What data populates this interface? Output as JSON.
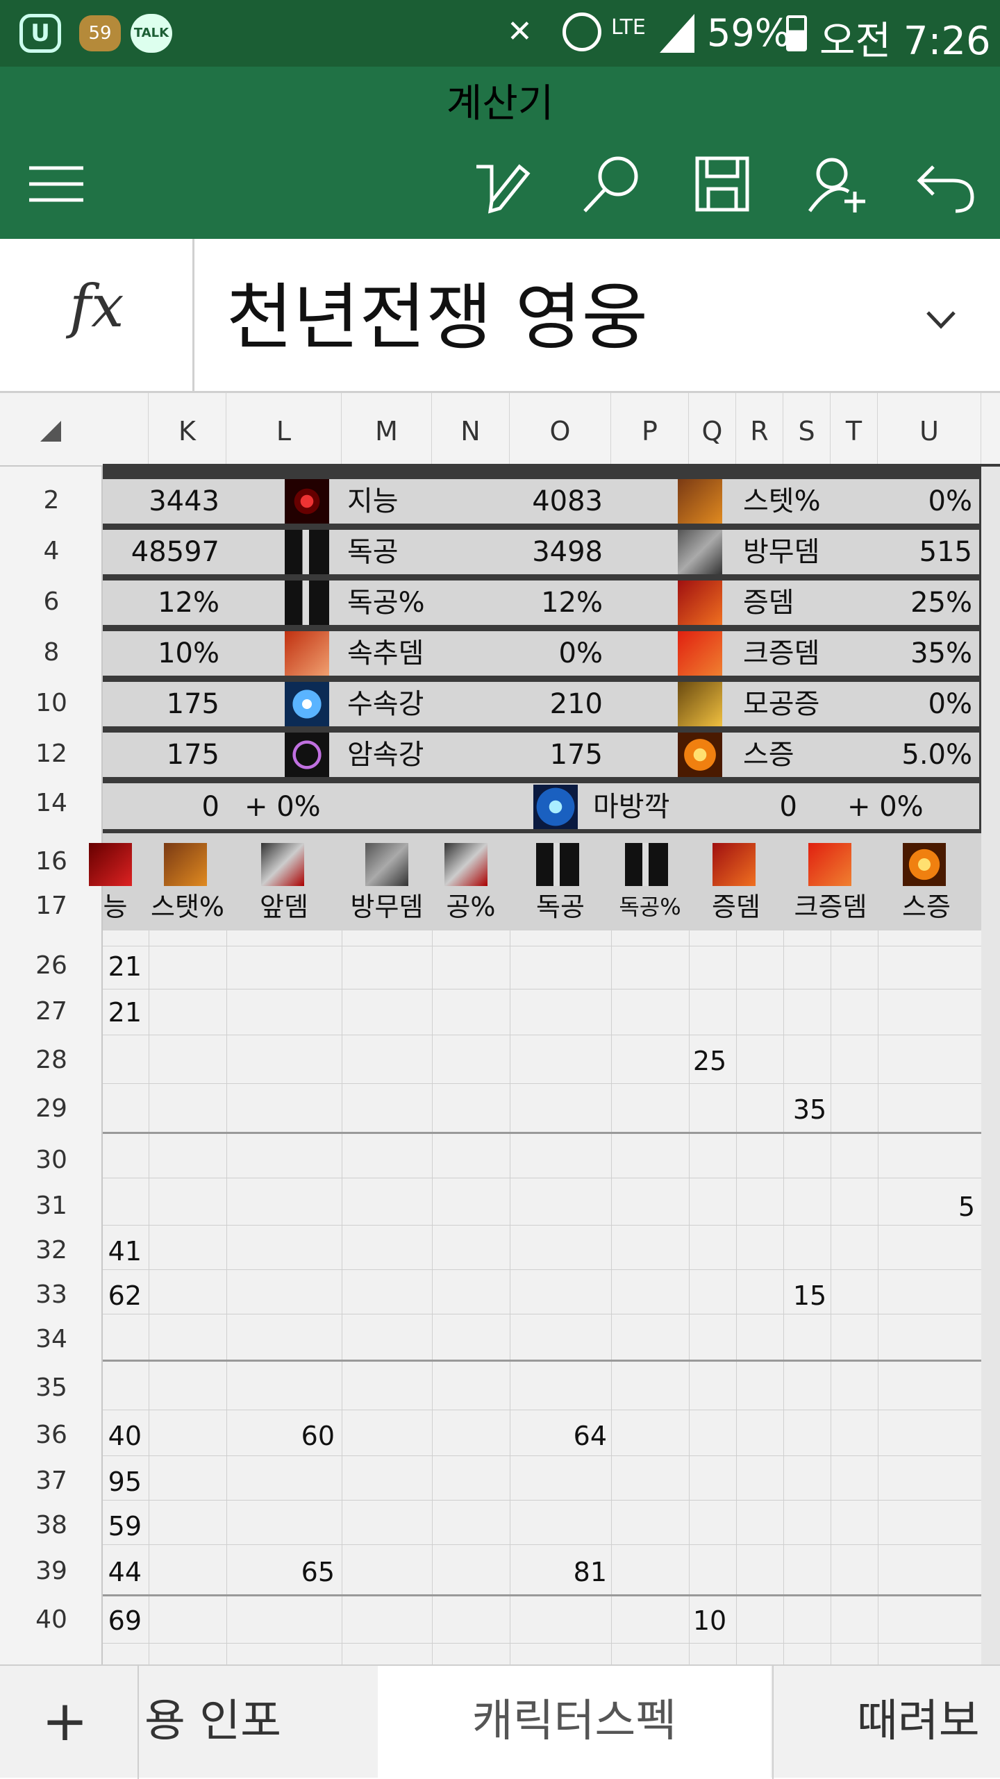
{
  "status_bar": {
    "battery": "59%",
    "network": "LTE",
    "time": "오전 7:26",
    "notif_badge": "59",
    "talk_label": "TALK"
  },
  "app": {
    "title": "계산기"
  },
  "formula_bar": {
    "fx_label": "fx",
    "content": "천년전쟁 영웅"
  },
  "columns": [
    "K",
    "L",
    "M",
    "N",
    "O",
    "P",
    "Q",
    "R",
    "S",
    "T",
    "U"
  ],
  "rows": {
    "panel_rows": [
      "2",
      "4",
      "6",
      "8",
      "10",
      "12",
      "14"
    ],
    "icon_rows": [
      "16",
      "17"
    ],
    "grid_rows": [
      "26",
      "27",
      "28",
      "29",
      "30",
      "31",
      "32",
      "33",
      "34",
      "35",
      "36",
      "37",
      "38",
      "39",
      "40"
    ]
  },
  "stats_panel": {
    "rows": [
      {
        "left": "3443",
        "mid_label": "지능",
        "mid_value": "4083",
        "right_label": "스텟%",
        "right_value": "0%"
      },
      {
        "left": "48597",
        "mid_label": "독공",
        "mid_value": "3498",
        "right_label": "방무뎀",
        "right_value": "515"
      },
      {
        "left": "12%",
        "mid_label": "독공%",
        "mid_value": "12%",
        "right_label": "증뎀",
        "right_value": "25%"
      },
      {
        "left": "10%",
        "mid_label": "속추뎀",
        "mid_value": "0%",
        "right_label": "크증뎀",
        "right_value": "35%"
      },
      {
        "left": "175",
        "mid_label": "수속강",
        "mid_value": "210",
        "right_label": "모공증",
        "right_value": "0%"
      },
      {
        "left": "175",
        "mid_label": "암속강",
        "mid_value": "175",
        "right_label": "스증",
        "right_value": "5.0%"
      }
    ],
    "last_row": {
      "left_value": "0",
      "left_plus": "+ 0%",
      "label": "마방깍",
      "value": "0",
      "plus": "+ 0%"
    }
  },
  "icon_header": {
    "labels": [
      "능",
      "스탯%",
      "앞뎀",
      "방무뎀",
      "공%",
      "독공",
      "독공%",
      "증뎀",
      "크증뎀",
      "스증"
    ]
  },
  "grid_cells": {
    "26": {
      "K": "21"
    },
    "27": {
      "K": "21"
    },
    "28": {
      "Q": "25"
    },
    "29": {
      "S": "35"
    },
    "31": {
      "U": "5"
    },
    "32": {
      "K": "41"
    },
    "33": {
      "K": "62",
      "S": "15"
    },
    "36": {
      "K": "40",
      "L": "60",
      "O": "64"
    },
    "37": {
      "K": "95"
    },
    "38": {
      "K": "59"
    },
    "39": {
      "K": "44",
      "L": "65",
      "O": "81"
    },
    "40": {
      "K": "69",
      "Q": "10"
    }
  },
  "sheet_tabs": {
    "add": "+",
    "tab1": "용 인포",
    "tab2": "캐릭터스펙",
    "tab3": "때려보"
  },
  "colors": {
    "toolbar": "#207245",
    "status": "#1b5e34",
    "panel_bg": "#3a3a3a",
    "band": "#d6d6d6"
  }
}
